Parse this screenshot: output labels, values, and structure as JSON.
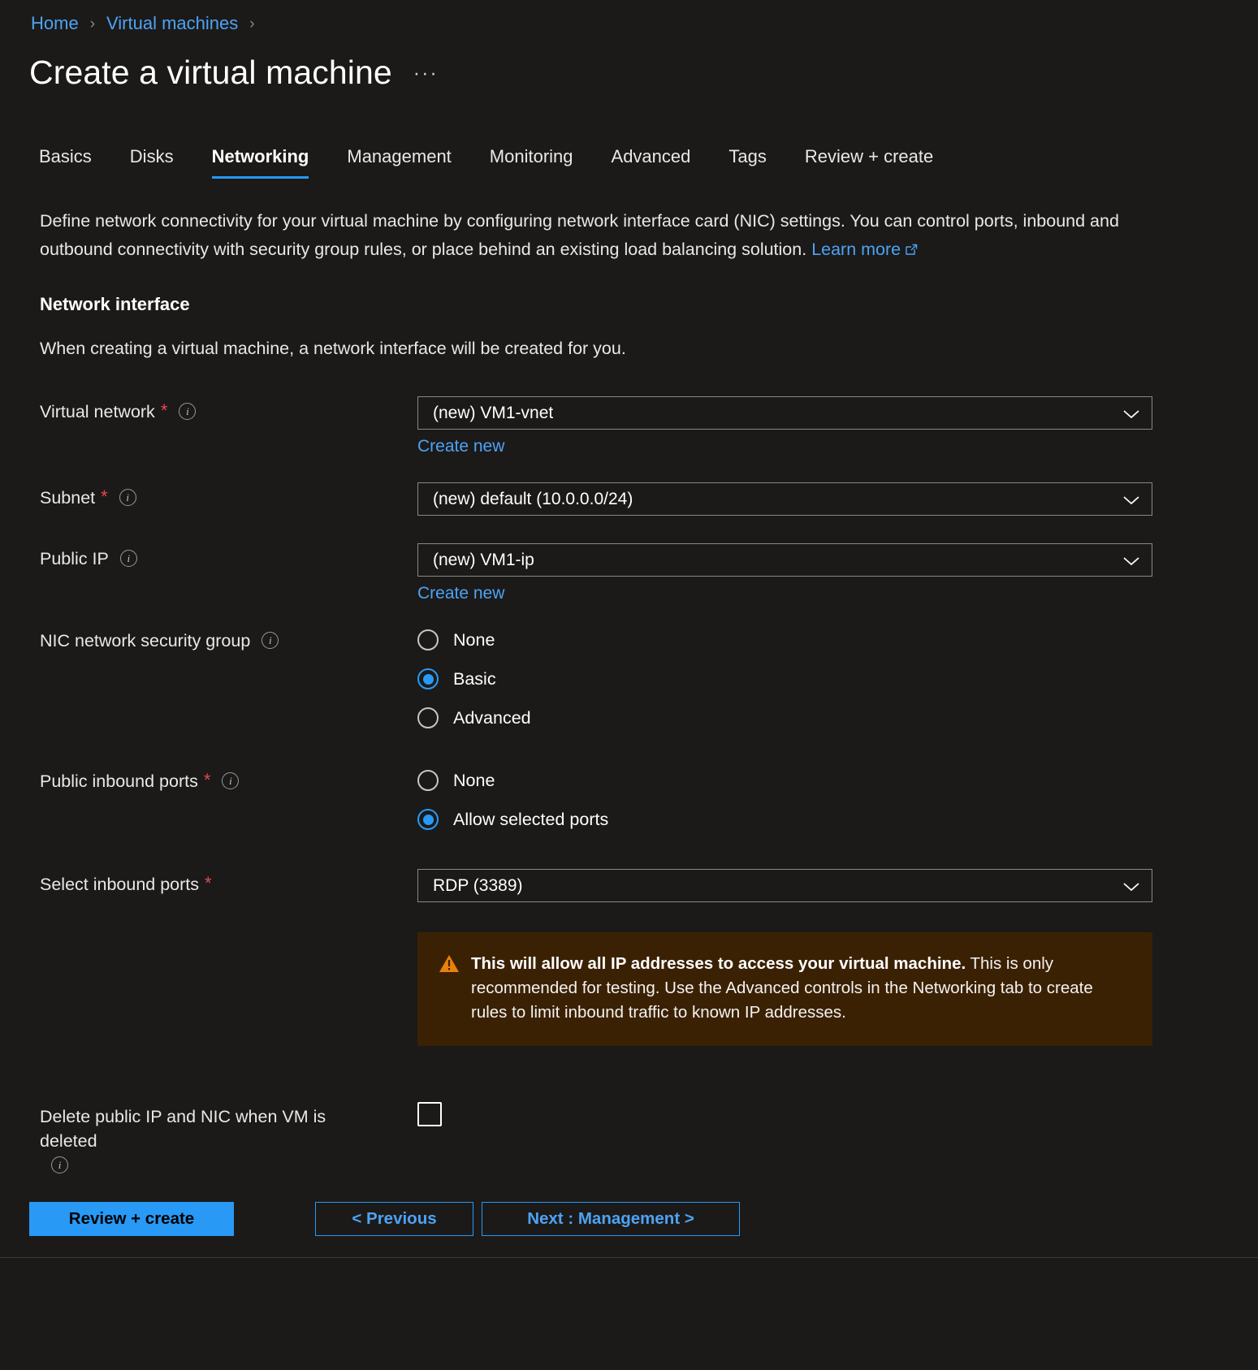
{
  "breadcrumb": {
    "items": [
      {
        "label": "Home"
      },
      {
        "label": "Virtual machines"
      }
    ],
    "separator": "›"
  },
  "header": {
    "title": "Create a virtual machine",
    "more_label": "···"
  },
  "tabs": [
    {
      "label": "Basics",
      "active": false
    },
    {
      "label": "Disks",
      "active": false
    },
    {
      "label": "Networking",
      "active": true
    },
    {
      "label": "Management",
      "active": false
    },
    {
      "label": "Monitoring",
      "active": false
    },
    {
      "label": "Advanced",
      "active": false
    },
    {
      "label": "Tags",
      "active": false
    },
    {
      "label": "Review + create",
      "active": false
    }
  ],
  "intro": {
    "text": "Define network connectivity for your virtual machine by configuring network interface card (NIC) settings. You can control ports, inbound and outbound connectivity with security group rules, or place behind an existing load balancing solution.",
    "link_label": "Learn more",
    "link_icon": "external-link-icon"
  },
  "section": {
    "heading": "Network interface",
    "description": "When creating a virtual machine, a network interface will be created for you."
  },
  "fields": {
    "virtual_network": {
      "label": "Virtual network",
      "required": "*",
      "info_icon": "info-icon",
      "value": "(new) VM1-vnet",
      "create_new_label": "Create new"
    },
    "subnet": {
      "label": "Subnet",
      "required": "*",
      "info_icon": "info-icon",
      "value": "(new) default (10.0.0.0/24)"
    },
    "public_ip": {
      "label": "Public IP",
      "info_icon": "info-icon",
      "value": "(new) VM1-ip",
      "create_new_label": "Create new"
    },
    "nic_nsg": {
      "label": "NIC network security group",
      "info_icon": "info-icon",
      "options": [
        {
          "label": "None",
          "selected": false
        },
        {
          "label": "Basic",
          "selected": true
        },
        {
          "label": "Advanced",
          "selected": false
        }
      ]
    },
    "public_inbound_ports": {
      "label": "Public inbound ports",
      "required": "*",
      "info_icon": "info-icon",
      "options": [
        {
          "label": "None",
          "selected": false
        },
        {
          "label": "Allow selected ports",
          "selected": true
        }
      ]
    },
    "select_inbound_ports": {
      "label": "Select inbound ports",
      "required": "*",
      "value": "RDP (3389)"
    },
    "delete_ip_nic": {
      "label": "Delete public IP and NIC when VM is deleted",
      "info_icon": "info-icon",
      "checked": false
    }
  },
  "warning": {
    "icon": "warning-triangle-icon",
    "bold_text": "This will allow all IP addresses to access your virtual machine.",
    "rest_text": " This is only recommended for testing.  Use the Advanced controls in the Networking tab to create rules to limit inbound traffic to known IP addresses."
  },
  "footer": {
    "review_create_label": "Review + create",
    "previous_label": "< Previous",
    "next_label": "Next : Management >"
  },
  "colors": {
    "background": "#1b1a19",
    "accent_blue": "#2899f5",
    "link_blue": "#4da3f5",
    "required_red": "#e9484a",
    "warning_bg": "#3b2103",
    "warning_orange": "#e8800c"
  }
}
